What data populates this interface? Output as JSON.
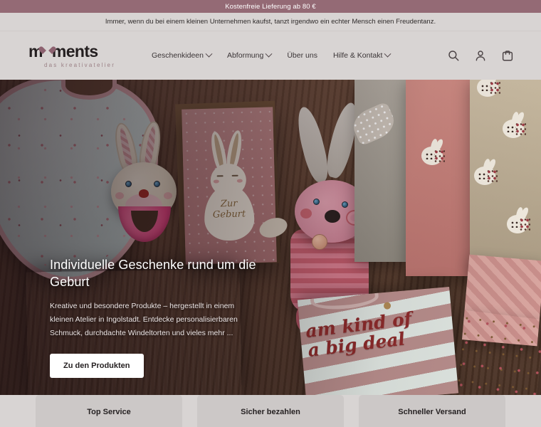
{
  "announcement": {
    "top_text": "Kostenfreie Lieferung ab 80 €",
    "sub_text": "Immer, wenn du bei einem kleinen Unternehmen kaufst, tanzt irgendwo ein echter Mensch einen Freudentanz.",
    "top_bg": "#946a75",
    "sub_bg": "#d8d4d3"
  },
  "logo": {
    "word_pre": "m",
    "word_post": "ments",
    "tagline": "das kreativatelier",
    "heart_color": "#8d6270"
  },
  "nav": {
    "items": [
      {
        "label": "Geschenkideen",
        "has_dropdown": true
      },
      {
        "label": "Abformung",
        "has_dropdown": true
      },
      {
        "label": "Über uns",
        "has_dropdown": false
      },
      {
        "label": "Hilfe & Kontakt",
        "has_dropdown": true
      }
    ]
  },
  "header_icons": [
    {
      "name": "search-icon",
      "label": "Suche"
    },
    {
      "name": "account-icon",
      "label": "Konto"
    },
    {
      "name": "cart-icon",
      "label": "Warenkorb"
    }
  ],
  "hero": {
    "title": "Individuelle Geschenke rund um die Geburt",
    "subtitle": "Kreative und besondere Produkte – hergestellt in einem kleinen Atelier in Ingolstadt. Entdecke personalisierbaren Schmuck, durchdachte Windeltorten und vieles mehr ...",
    "button_label": "Zu den Produkten",
    "card_text_line1": "Zur",
    "card_text_line2": "Geburt",
    "shirt_text_line1": "am kind of",
    "shirt_text_line2": "a big deal"
  },
  "services": {
    "cards": [
      {
        "label": "Top Service"
      },
      {
        "label": "Sicher bezahlen"
      },
      {
        "label": "Schneller Versand"
      }
    ]
  },
  "colors": {
    "page_bg": "#d8d4d3",
    "accent": "#946a75",
    "card_bg": "#ccc8c7",
    "text_dark": "#241f20"
  }
}
